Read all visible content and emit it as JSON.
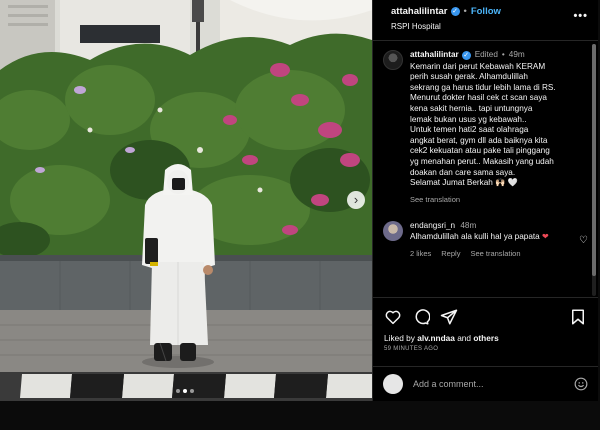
{
  "post": {
    "username": "attahalilintar",
    "follow_label": "Follow",
    "location": "RSPI Hospital",
    "more_icon": "more-horizontal-icon"
  },
  "caption": {
    "username": "attahalilintar",
    "edited": "Edited",
    "time": "49m",
    "text": "Kemarin dari perut Kebawah KERAM\nperih susah gerak. Alhamdulillah\nsekrang ga harus tidur lebih lama di RS.\nMenurut dokter hasil cek ct scan saya\nkena sakit hernia.. tapi untungnya\nlemak bukan usus yg kebawah..\nUntuk temen hati2 saat olahraga\nangkat berat, gym dll ada baiknya kita\ncek2 kekuatan atau pake tali pinggang\nyg menahan perut.. Makasih yang udah\ndoakan dan care sama saya.\nSelamat Jumat Berkah 🙌🏻 🤍",
    "see_translation": "See translation"
  },
  "comment": {
    "username": "endangsri_n",
    "time": "48m",
    "text": "Alhamdulillah ala kulli hal ya papata",
    "likes": "2 likes",
    "reply": "Reply",
    "see_translation": "See translation"
  },
  "engagement": {
    "liked_prefix": "Liked by",
    "liked_user": "alv.nndaa",
    "liked_and": "and",
    "liked_others": "others",
    "time_ago": "59 MINUTES AGO"
  },
  "add_comment": {
    "placeholder": "Add a comment..."
  },
  "carousel": {
    "slide_count": 3,
    "active_index": 1
  },
  "colors": {
    "accent": "#4cb5f9",
    "verified": "#3897f0",
    "heart": "#ed4956",
    "panel_bg": "#000000"
  }
}
